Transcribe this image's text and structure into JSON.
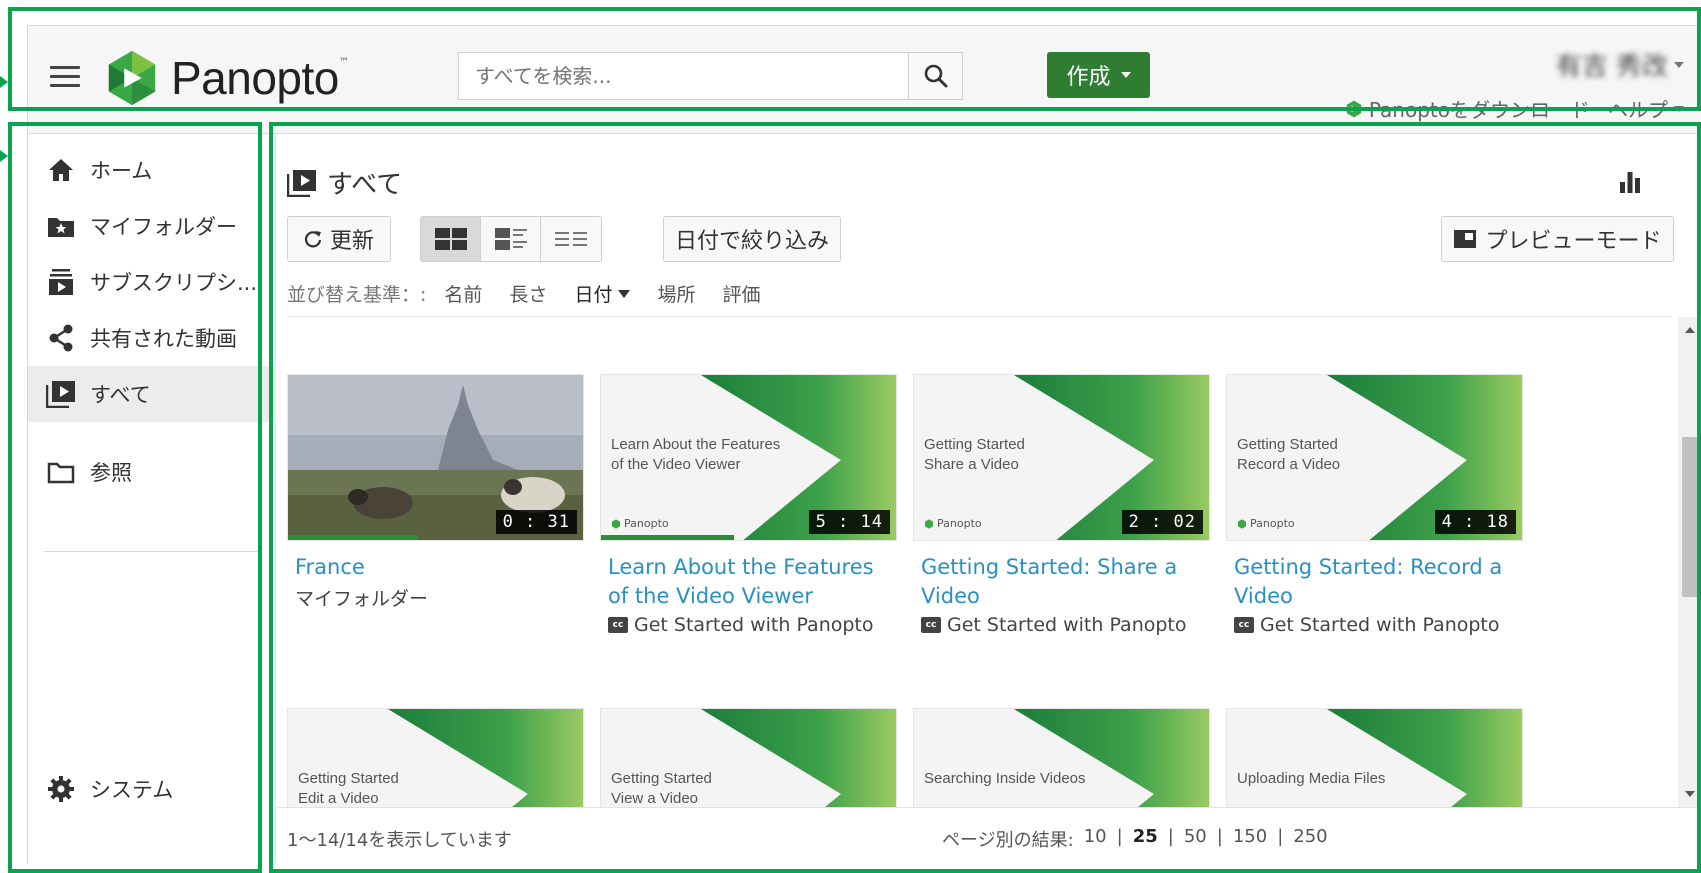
{
  "header": {
    "logo_text": "Panopto",
    "logo_tm": "™",
    "search_placeholder": "すべてを検索...",
    "create_label": "作成",
    "user_name": "有吉 秀改",
    "download_label": "Panoptoをダウンロード",
    "help_label": "ヘルプ"
  },
  "sidebar": {
    "items": [
      {
        "label": "ホーム",
        "icon": "home-icon"
      },
      {
        "label": "マイフォルダー",
        "icon": "star-folder-icon"
      },
      {
        "label": "サブスクリプシ...",
        "icon": "subscription-icon"
      },
      {
        "label": "共有された動画",
        "icon": "share-icon"
      },
      {
        "label": "すべて",
        "icon": "video-library-icon"
      },
      {
        "label": "参照",
        "icon": "folder-icon"
      }
    ],
    "system_label": "システム"
  },
  "main": {
    "title": "すべて",
    "refresh_label": "更新",
    "date_filter_label": "日付で絞り込み",
    "preview_label": "プレビューモード",
    "sort": {
      "label": "並び替え基準：:",
      "options": [
        "名前",
        "長さ",
        "日付",
        "場所",
        "評価"
      ],
      "active": "日付"
    },
    "sessions": [
      {
        "title": "France",
        "subtitle": "マイフォルダー",
        "duration": "0 : 31",
        "thumb_type": "photo",
        "progress_pct": 44,
        "cc": false
      },
      {
        "title": "Learn About the Features of the Video Viewer",
        "subtitle": "Get Started with Panopto",
        "duration": "5 : 14",
        "thumb_type": "green",
        "thumb_text": [
          "Learn About the Features",
          "of the Video Viewer"
        ],
        "progress_pct": 45,
        "cc": true
      },
      {
        "title": "Getting Started: Share a Video",
        "subtitle": "Get Started with Panopto",
        "duration": "2 : 02",
        "thumb_type": "green",
        "thumb_text": [
          "Getting Started",
          "Share a Video"
        ],
        "progress_pct": 0,
        "cc": true
      },
      {
        "title": "Getting Started: Record a Video",
        "subtitle": "Get Started with Panopto",
        "duration": "4 : 18",
        "thumb_type": "green",
        "thumb_text": [
          "Getting Started",
          "Record a Video"
        ],
        "progress_pct": 0,
        "cc": true
      },
      {
        "thumb_type": "green",
        "thumb_text": [
          "Getting Started",
          "Edit a Video"
        ]
      },
      {
        "thumb_type": "green",
        "thumb_text": [
          "Getting Started",
          "View a Video"
        ]
      },
      {
        "thumb_type": "green",
        "thumb_text": [
          "Searching Inside Videos"
        ]
      },
      {
        "thumb_type": "green",
        "thumb_text": [
          "Uploading Media Files"
        ]
      }
    ],
    "thumb_logo_text": "Panopto",
    "footer": {
      "showing_text": "1～14/14を表示しています",
      "per_page_label": "ページ別の結果:",
      "per_page_options": [
        "10",
        "25",
        "50",
        "150",
        "250"
      ],
      "per_page_active": "25"
    }
  },
  "colors": {
    "brand_green": "#2e7d32",
    "link_blue": "#2a8fc4",
    "annotation_green": "#0aa34f"
  }
}
